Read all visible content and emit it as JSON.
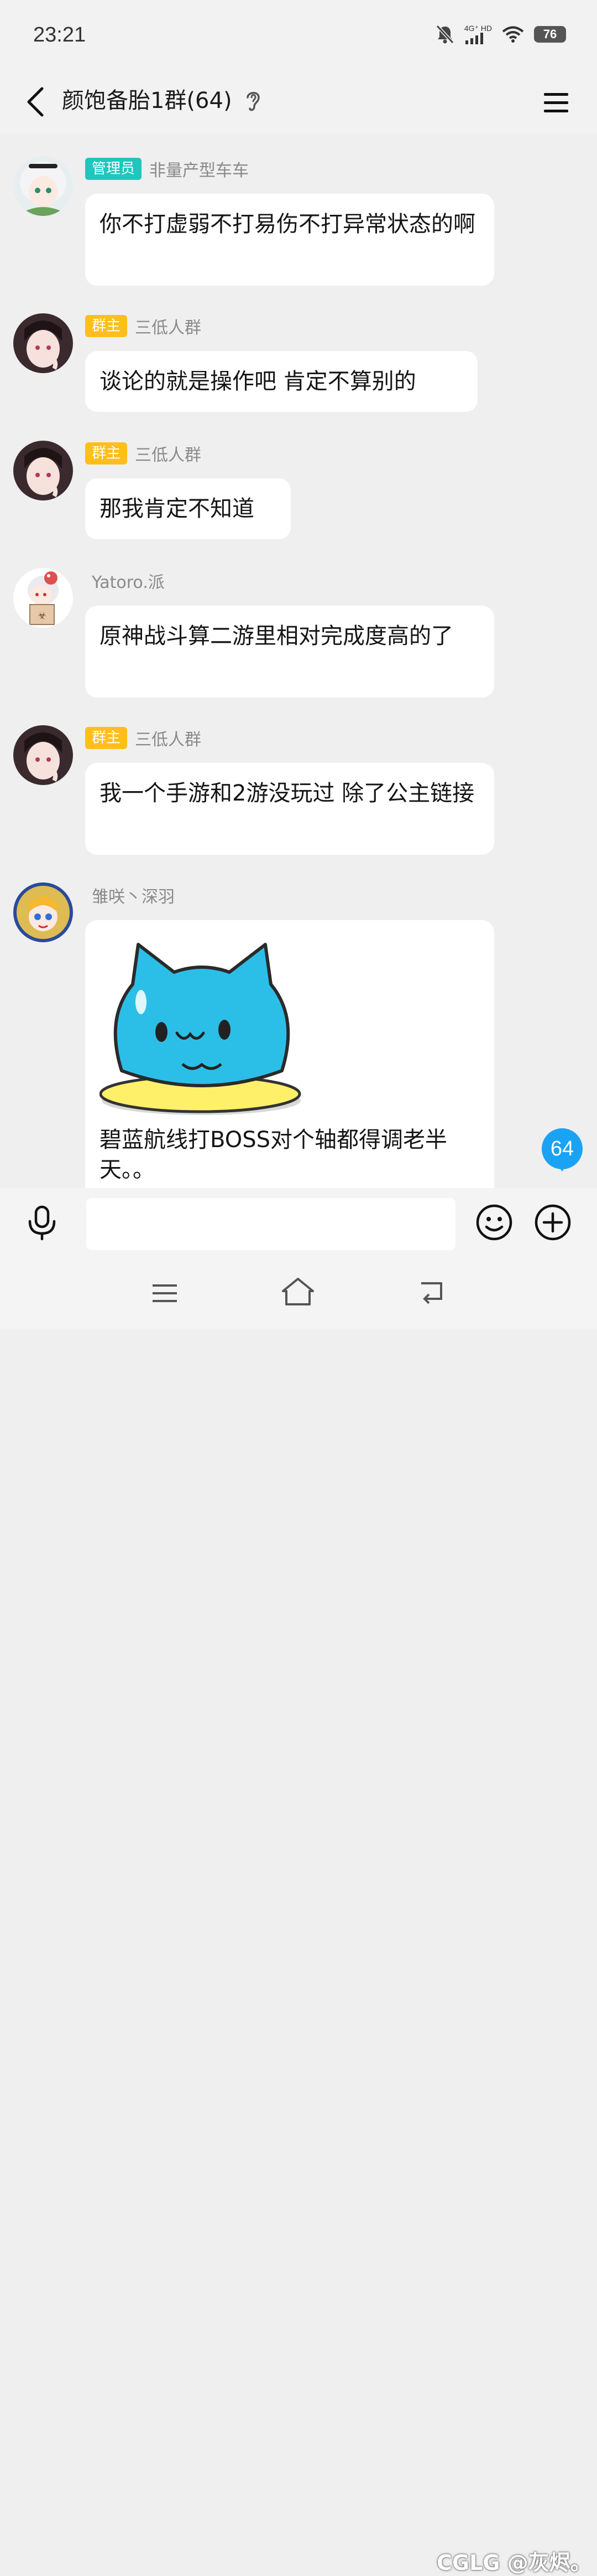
{
  "status": {
    "time": "23:21",
    "network": "4G⁺ HD",
    "battery": "76"
  },
  "header": {
    "title": "颜饱备胎1群(64)"
  },
  "messages": [
    {
      "role": "管理员",
      "sender": "非量产型车车",
      "text": "你不打虚弱不打易伤不打异常状态的啊"
    },
    {
      "role": "群主",
      "sender": "三低人群",
      "text": "谈论的就是操作吧 肯定不算别的"
    },
    {
      "role": "群主",
      "sender": "三低人群",
      "text": "那我肯定不知道"
    },
    {
      "role": "",
      "sender": "Yatoro.派",
      "text": "原神战斗算二游里相对完成度高的了"
    },
    {
      "role": "群主",
      "sender": "三低人群",
      "text": "我一个手游和2游没玩过 除了公主链接"
    },
    {
      "role": "",
      "sender": "雏咲丶深羽",
      "text": "碧蓝航线打BOSS对个轴都得调老半天。。"
    }
  ],
  "unread_count": "64",
  "input": {
    "placeholder": ""
  },
  "watermark": "CGLG @灰烬。",
  "colors": {
    "admin_badge": "#1fc6bd",
    "owner_badge": "#ffbe1a",
    "unread": "#1aa3f5"
  }
}
